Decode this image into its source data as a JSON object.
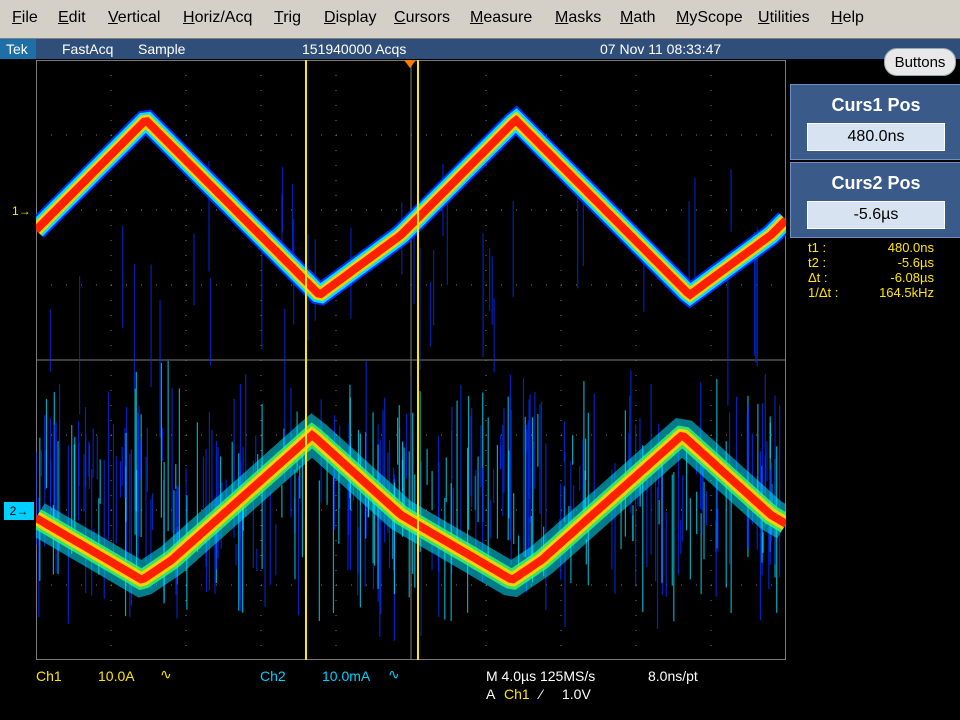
{
  "menu": [
    {
      "label": "File",
      "u": "F",
      "rest": "ile"
    },
    {
      "label": "Edit",
      "u": "E",
      "rest": "dit"
    },
    {
      "label": "Vertical",
      "u": "V",
      "rest": "ertical"
    },
    {
      "label": "Horiz/Acq",
      "u": "H",
      "rest": "oriz/Acq"
    },
    {
      "label": "Trig",
      "u": "T",
      "rest": "rig"
    },
    {
      "label": "Display",
      "u": "D",
      "rest": "isplay"
    },
    {
      "label": "Cursors",
      "u": "C",
      "rest": "ursors"
    },
    {
      "label": "Measure",
      "u": "M",
      "rest": "easure"
    },
    {
      "label": "Masks",
      "u": "M",
      "rest": "asks"
    },
    {
      "label": "Math",
      "u": "M",
      "rest": "ath"
    },
    {
      "label": "MyScope",
      "u": "M",
      "rest": "yScope"
    },
    {
      "label": "Utilities",
      "u": "U",
      "rest": "tilities"
    },
    {
      "label": "Help",
      "u": "H",
      "rest": "elp"
    }
  ],
  "status": {
    "brand": "Tek",
    "mode": "FastAcq",
    "acq_type": "Sample",
    "acqs": "151940000 Acqs",
    "datetime": "07 Nov 11 08:33:47"
  },
  "buttons_label": "Buttons",
  "cursors": {
    "c1_title": "Curs1 Pos",
    "c1_value": "480.0ns",
    "c2_title": "Curs2 Pos",
    "c2_value": "-5.6µs"
  },
  "readout": [
    {
      "k": "t1 :",
      "v": "480.0ns"
    },
    {
      "k": "t2 :",
      "v": "-5.6µs"
    },
    {
      "k": "Δt :",
      "v": "-6.08µs"
    },
    {
      "k": "1/Δt :",
      "v": "164.5kHz"
    }
  ],
  "markers": {
    "ch1": "1",
    "ch2": "2"
  },
  "bottom": {
    "ch1_label": "Ch1",
    "ch1_scale": "10.0A",
    "ch1_bw": "∿",
    "ch2_label": "Ch2",
    "ch2_scale": "10.0mA",
    "ch2_bw": "∿",
    "timebase": "M 4.0µs 125MS/s",
    "resolution": "8.0ns/pt",
    "trigger_prefix": "A",
    "trigger_src": "Ch1",
    "trigger_slope": "⁄",
    "trigger_level": "1.0V"
  },
  "colors": {
    "ch1": "#ffe600",
    "ch2": "#00d0ff",
    "grid": "#7a7a7a",
    "hot": "#ff2000",
    "warm": "#ffd000",
    "cool": "#00e0ff",
    "cold": "#0030ff",
    "cursor": "#ffe600"
  }
}
